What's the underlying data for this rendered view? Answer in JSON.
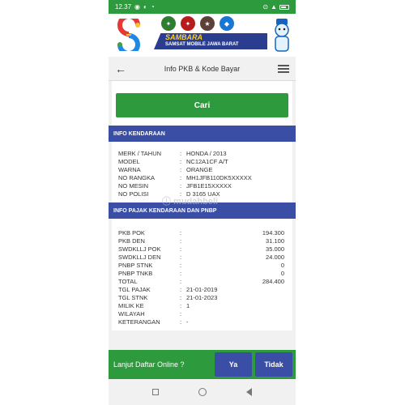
{
  "status_bar": {
    "time": "12.37",
    "icons": [
      "whatsapp-icon",
      "location-icon",
      "wifi-icon"
    ],
    "right_icons": [
      "alarm-icon",
      "signal-icon",
      "battery-icon"
    ]
  },
  "banner": {
    "brand_title": "SAMBARA",
    "brand_subtitle": "SAMSAT MOBILE JAWA BARAT"
  },
  "topbar": {
    "title": "Info PKB & Kode Bayar"
  },
  "search": {
    "button_label": "Cari"
  },
  "kendaraan": {
    "header": "INFO KENDARAAN",
    "rows": [
      {
        "label": "MERK / TAHUN",
        "value": "HONDA / 2013"
      },
      {
        "label": "MODEL",
        "value": "NC12A1CF A/T"
      },
      {
        "label": "WARNA",
        "value": "ORANGE"
      },
      {
        "label": "NO RANGKA",
        "value": "MH1JFB110DK5XXXXX"
      },
      {
        "label": "NO MESIN",
        "value": "JFB1E15XXXXX"
      },
      {
        "label": "NO POLISI",
        "value": "D 3165 UAX"
      }
    ]
  },
  "pajak": {
    "header": "INFO PAJAK KENDARAAN DAN PNBP",
    "amounts": [
      {
        "label": "PKB POK",
        "value": "194.300"
      },
      {
        "label": "PKB DEN",
        "value": "31.100"
      },
      {
        "label": "SWDKLLJ POK",
        "value": "35.000"
      },
      {
        "label": "SWDKLLJ DEN",
        "value": "24.000"
      },
      {
        "label": "PNBP STNK",
        "value": "0"
      },
      {
        "label": "PNBP TNKB",
        "value": "0"
      },
      {
        "label": "TOTAL",
        "value": "284.400"
      }
    ],
    "details": [
      {
        "label": "TGL PAJAK",
        "value": "21-01-2019"
      },
      {
        "label": "TGL STNK",
        "value": "21-01-2023"
      },
      {
        "label": "MILIK KE",
        "value": "1"
      },
      {
        "label": "WILAYAH",
        "value": ""
      },
      {
        "label": "KETERANGAN",
        "value": "-"
      }
    ]
  },
  "watermark": {
    "text": "ⓘ mudahbeli"
  },
  "bottom": {
    "question": "Lanjut Daftar Online ?",
    "yes_label": "Ya",
    "no_label": "Tidak"
  },
  "colors": {
    "green": "#2e9a3e",
    "blue": "#3a4ea6"
  }
}
